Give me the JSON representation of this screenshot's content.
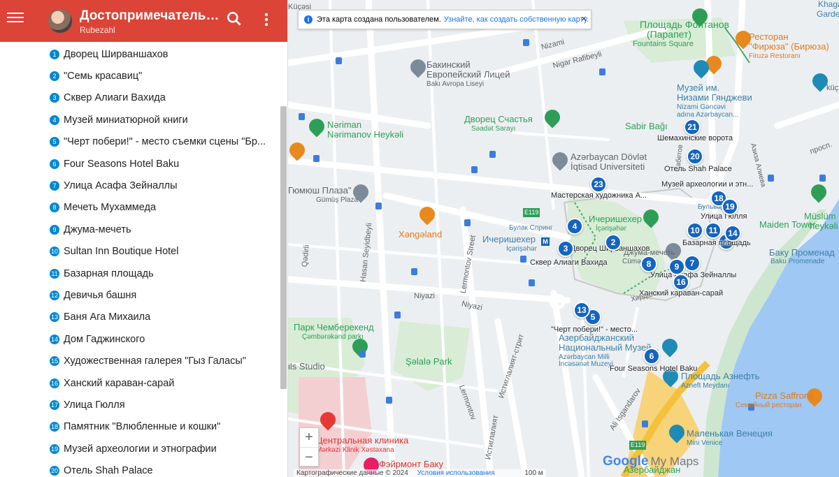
{
  "header": {
    "title": "Достопримечательн...",
    "author": "Rubezahl"
  },
  "places": [
    {
      "n": "1",
      "name": "Дворец Ширваншахов"
    },
    {
      "n": "2",
      "name": "\"Семь красавиц\""
    },
    {
      "n": "3",
      "name": "Сквер Алиаги Вахида"
    },
    {
      "n": "4",
      "name": "Музей миниатюрной книги"
    },
    {
      "n": "5",
      "name": "\"Черт побери!\" - место съемки сцены \"Бр..."
    },
    {
      "n": "6",
      "name": "Four Seasons Hotel Baku"
    },
    {
      "n": "7",
      "name": "Улица Асафа Зейналлы"
    },
    {
      "n": "8",
      "name": "Мечеть Мухаммеда"
    },
    {
      "n": "9",
      "name": "Джума-мечеть"
    },
    {
      "n": "10",
      "name": "Sultan Inn Boutique Hotel"
    },
    {
      "n": "11",
      "name": "Базарная площадь"
    },
    {
      "n": "12",
      "name": "Девичья башня"
    },
    {
      "n": "13",
      "name": "Баня Ага Михаила"
    },
    {
      "n": "14",
      "name": "Дом Гаджинского"
    },
    {
      "n": "15",
      "name": "Художественная галерея \"Гыз Галасы\""
    },
    {
      "n": "16",
      "name": "Ханский караван-сарай"
    },
    {
      "n": "17",
      "name": "Улица Гюлля"
    },
    {
      "n": "18",
      "name": "Памятник \"Влюбленные и кошки\""
    },
    {
      "n": "19",
      "name": "Музей археологии и этнографии"
    },
    {
      "n": "20",
      "name": "Отель Shah Palace"
    }
  ],
  "notice": {
    "text": "Эта карта создана пользователем.",
    "link": "Узнайте, как создать собственную карту.",
    "close": "×"
  },
  "zoom": {
    "in": "+",
    "out": "−"
  },
  "logo": {
    "google": "Google",
    "mymaps": "My Maps"
  },
  "attribution": {
    "data": "Картографические данные © 2024",
    "terms": "Условия использования",
    "scale": "100 м"
  },
  "map_labels": {
    "fountains_ru": "Площадь Фонтанов",
    "fountains_sub": "(Парапет)",
    "fountains_en": "Fountains Square",
    "firuza_ru": "Ресторан",
    "firuza_name": "\"Фирюза\" (Бирюза)",
    "firuza_en": "Firuzə Restoranı",
    "lyceum1": "Бакинский",
    "lyceum2": "Европейский Лицей",
    "lyceum3": "Bakı Avropa Liseyi",
    "nizami_street": "Nizami",
    "nigar": "Nigar Rafibeyli",
    "nizami_museum1": "Музей им.",
    "nizami_museum2": "Низами Гянджеви",
    "nizami_museum3": "Nizami Gəncəvi",
    "nizami_museum4": "adına Azərbaycan...",
    "narimanov1": "Nəriman",
    "narimanov2": "Nərimanov Heykəli",
    "saadat1": "Дворец Счастья",
    "saadat2": "Səadət Sarayı",
    "sabir": "Sabir Bağı",
    "university1": "Azərbaycan Dövlət",
    "university2": "İqtisad Universiteti",
    "gumush1": "Гюмюш Плаза\"",
    "gumush2": "Gümüş Plaza",
    "xangeland": "Xəngəland",
    "icherisheher_metro1": "Ичеришехер",
    "icherisheher_metro2": "İçərişəhər",
    "bulvar_spring": "Булак Спринг",
    "icherisheher1": "Ичеришехер",
    "icherisheher2": "İçərişəhər",
    "e119": "E119",
    "e119b": "E119",
    "hasan": "Hasan Seyidbeyli",
    "lermontov": "Lermontov Street",
    "niyazi1": "Niyazi",
    "niyazi2": "Niyazi",
    "qadirli": "Qədirli",
    "chemberekend1": "Парк Чемберекенд",
    "chemberekend2": "Çəmbərəkənd parkı",
    "shelale": "Şəlalə Park",
    "studio": "ils Studio",
    "national_museum1": "Азербайджанский",
    "national_museum2": "Национальный Музей...",
    "national_museum3": "Azərbaycan Milli",
    "national_museum4": "İncəsənət Muzeyi",
    "istiqlaliyyet": "Истиглалият-стрит",
    "istiqlaliyyet2": "Истиглалият",
    "lermontov2": "Lermontov",
    "ali_isgandarov": "Ali Isgandarov",
    "azneft1": "Площадь Азнефть",
    "azneft2": "Azneft Meydanı",
    "pizza1": "Pizza Saffrone",
    "pizza2": "Семейный ресторан",
    "venice1": "Маленькая Венеция",
    "venice2": "Mini Venice",
    "clinic1": "Центральная клиника",
    "clinic2": "Mərkəzi Klinik Xəstəxana",
    "fairmont": "Фэйрмонт Баку",
    "maiden": "Maiden Tower",
    "baku_prom1": "Баку Променад",
    "baku_prom2": "Baku Promenade",
    "muslim1": "Müslüm",
    "muslim2": "heykəli",
    "prosp": "просп.",
    "kuchesi": "Küçəsi",
    "khagani1": "Khagani",
    "khagani2": "Gardens",
    "kuchesi2": "küç.",
    "sabitov": "Сабетов",
    "azerbaijan_bottom": "Азербайджан",
    "bulvar": "Бульвар",
    "jumet": "Джума-мечеть",
    "cume": "Cümə",
    "xirdalan": "Хирдала",
    "aliyeva": "Азиза Алиева"
  },
  "map_markers": [
    {
      "n": "1",
      "label": "Дворец Ширваншахов"
    },
    {
      "n": "2",
      "label": ""
    },
    {
      "n": "3",
      "label": "Сквер Алиаги Вахида"
    },
    {
      "n": "4",
      "label": ""
    },
    {
      "n": "5",
      "label": "\"Черт побери!\" - место..."
    },
    {
      "n": "6",
      "label": "Four Seasons Hotel Baku"
    },
    {
      "n": "7",
      "label": "Улица Асафа Зейналлы"
    },
    {
      "n": "8",
      "label": ""
    },
    {
      "n": "9",
      "label": ""
    },
    {
      "n": "10",
      "label": "Базарная площадь"
    },
    {
      "n": "11",
      "label": ""
    },
    {
      "n": "13",
      "label": ""
    },
    {
      "n": "14",
      "label": ""
    },
    {
      "n": "16",
      "label": "Ханский караван-сарай"
    },
    {
      "n": "18",
      "label": "Улица Гюлля"
    },
    {
      "n": "19",
      "label": "Музей археологии и этн..."
    },
    {
      "n": "20",
      "label": "Отель Shah Palace"
    },
    {
      "n": "21",
      "label": "Шемахинские ворота"
    },
    {
      "n": "23",
      "label": "Мастерская художника А..."
    }
  ]
}
